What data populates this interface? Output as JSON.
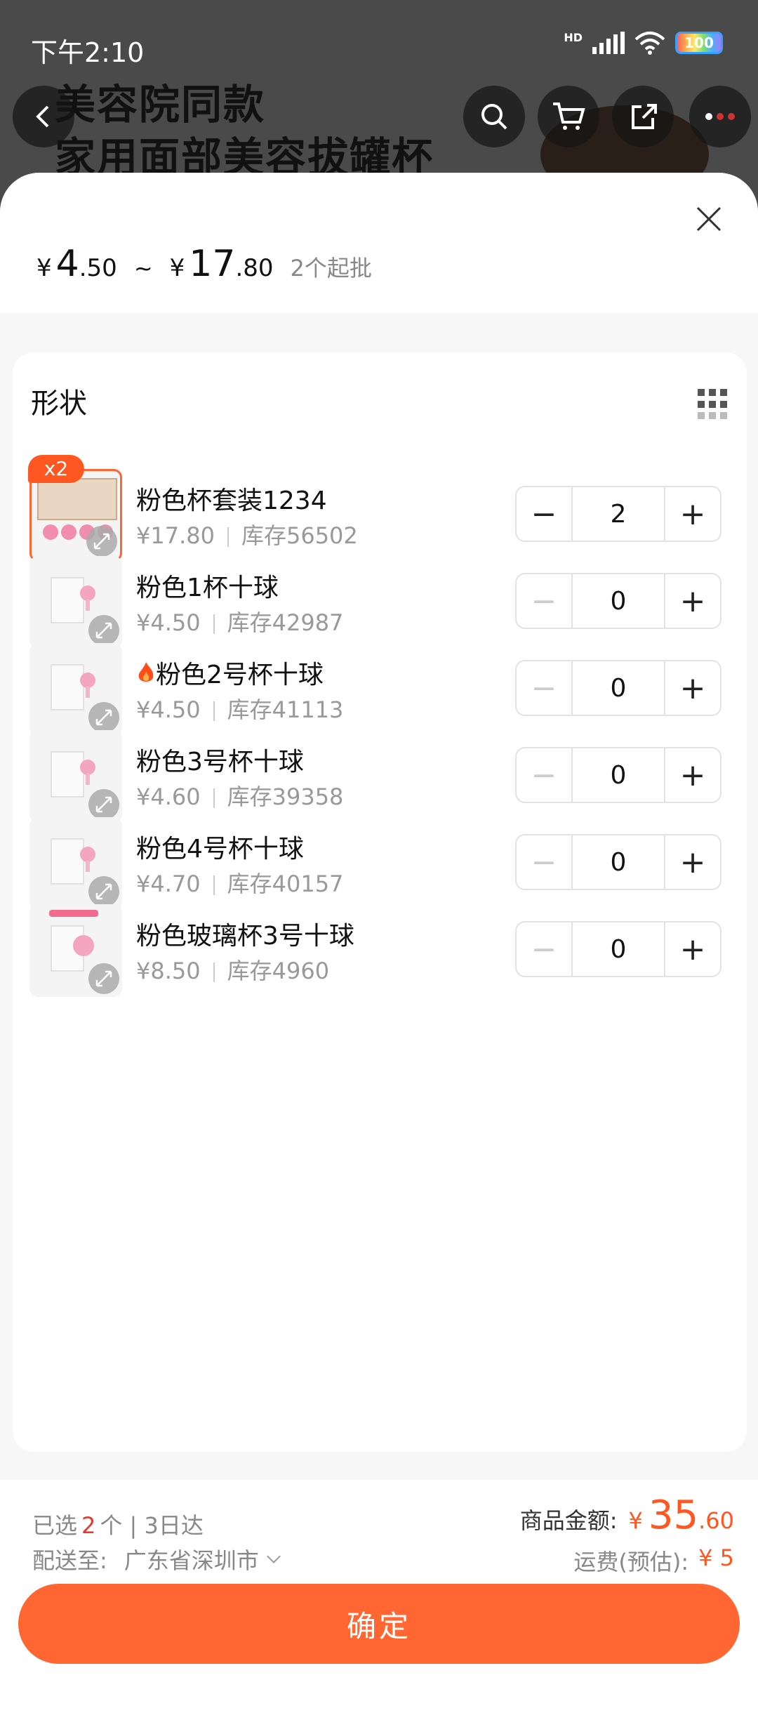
{
  "status_bar": {
    "time": "下午2:10",
    "hd": "HD",
    "battery": "100"
  },
  "background": {
    "title_line1": "美容院同款",
    "title_line2": "家用面部美容拔罐杯"
  },
  "sheet": {
    "price_range": {
      "currency": "¥",
      "min_int": "4",
      "min_dec": ".50",
      "separator": "~",
      "max_int": "17",
      "max_dec": ".80",
      "min_batch": "2个起批"
    },
    "section_title": "形状",
    "items": [
      {
        "badge": "x2",
        "name": "粉色杯套装1234",
        "price": "¥17.80",
        "stock": "库存56502",
        "qty": "2",
        "selected": true
      },
      {
        "name": "粉色1杯十球",
        "price": "¥4.50",
        "stock": "库存42987",
        "qty": "0"
      },
      {
        "name": "粉色2号杯十球",
        "price": "¥4.50",
        "stock": "库存41113",
        "qty": "0",
        "hot": true
      },
      {
        "name": "粉色3号杯十球",
        "price": "¥4.60",
        "stock": "库存39358",
        "qty": "0"
      },
      {
        "name": "粉色4号杯十球",
        "price": "¥4.70",
        "stock": "库存40157",
        "qty": "0"
      },
      {
        "name": "粉色玻璃杯3号十球",
        "price": "¥8.50",
        "stock": "库存4960",
        "qty": "0"
      }
    ],
    "stepper": {
      "minus": "−",
      "plus": "+"
    }
  },
  "footer": {
    "selected_prefix": "已选",
    "selected_count": "2",
    "selected_suffix": "个 | 3日达",
    "ship_label": "配送至:",
    "ship_address": "广东省深圳市",
    "amount_label": "商品金额:",
    "amount_currency": "¥",
    "amount_int": "35",
    "amount_dec": ".60",
    "freight_label": "运费(预估):",
    "freight_value": "¥ 5",
    "confirm_label": "确定"
  },
  "colors": {
    "accent": "#ff6631",
    "price": "#ff5722",
    "count": "#e63a2e"
  }
}
